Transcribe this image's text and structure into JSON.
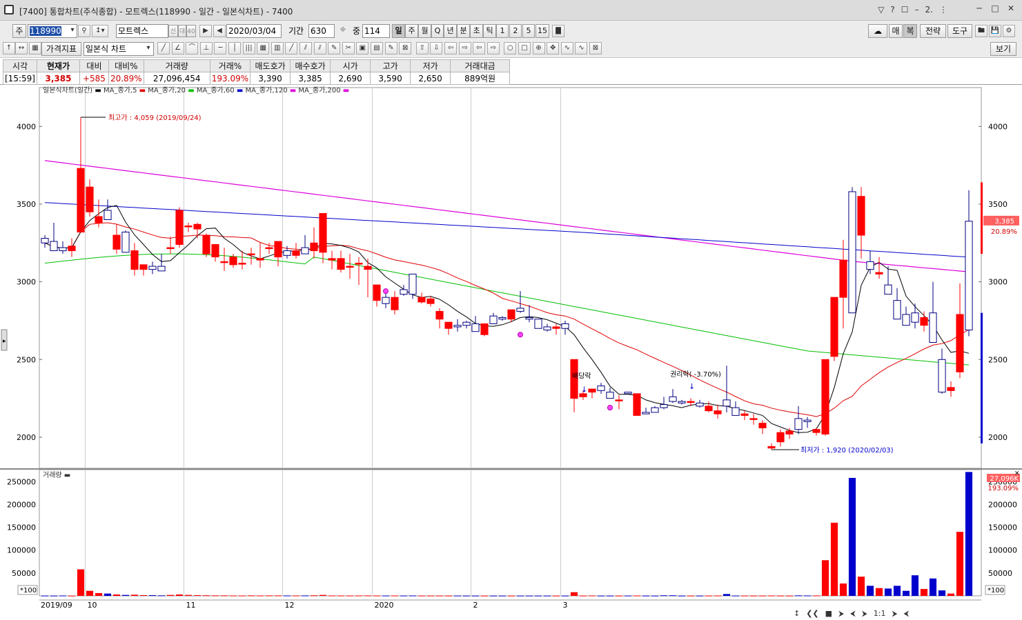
{
  "window": {
    "title": "[7400] 통합차트(주식종합) - 모트렉스(118990 - 일간 - 일본식차트) - 7400",
    "top_icons": [
      "▽",
      "?",
      "☐",
      "–",
      "2.",
      "⋮"
    ]
  },
  "toolbar1": {
    "market_label": "주",
    "code": "118990",
    "name": "모트렉스",
    "name_badges": [
      "신",
      "대",
      "40"
    ],
    "date": "2020/03/04",
    "period_label": "기간",
    "period_value": "630",
    "count_label": "중",
    "count_value": "114",
    "intervals": [
      "일",
      "주",
      "월",
      "Q",
      "년",
      "분",
      "초",
      "틱",
      "1",
      "2",
      "5",
      "15"
    ],
    "right_buttons": [
      "매",
      "복",
      "전략",
      "도구"
    ]
  },
  "toolbar2": {
    "price_index": "가격지표",
    "chart_type": "일본식 차트",
    "view_label": "보기"
  },
  "quote": {
    "headers": [
      "시각",
      "현재가",
      "대비",
      "대비%",
      "거래량",
      "거래%",
      "매도호가",
      "매수호가",
      "시가",
      "고가",
      "저가",
      "거래대금"
    ],
    "values": [
      "[15:59]",
      "3,385",
      "+585",
      "20.89%",
      "27,096,454",
      "193.09%",
      "3,390",
      "3,385",
      "2,690",
      "3,590",
      "2,650",
      "889억원"
    ]
  },
  "chart_data": {
    "type": "candlestick",
    "title": "일본식차트(일간)",
    "legend": [
      "MA_종가,5",
      "MA_종가,20",
      "MA_종가,60",
      "MA_종가,120",
      "MA_종가,200"
    ],
    "legend_colors": [
      "#000000",
      "#e00000",
      "#00c000",
      "#0000cc",
      "#dd00dd"
    ],
    "y_ticks": [
      2000,
      2500,
      3000,
      3500,
      4000
    ],
    "ylim": [
      1800,
      4250
    ],
    "x_labels": [
      "2019/09",
      "10",
      "11",
      "12",
      "2020",
      "2",
      "3"
    ],
    "x_label_idx": [
      0,
      5,
      16,
      27,
      37,
      48,
      58
    ],
    "annotations": {
      "high": "최고가 : 4,059 (2019/09/24)",
      "low": "최저가 : 1,920 (2020/02/03)",
      "dividend": "배당락",
      "rights": "권리락( -3.70%)"
    },
    "candles": [
      [
        3280,
        3300,
        3220,
        3250
      ],
      [
        3260,
        3380,
        3200,
        3200
      ],
      [
        3220,
        3260,
        3180,
        3200
      ],
      [
        3200,
        3280,
        3160,
        3230
      ],
      [
        3320,
        4059,
        3320,
        3730
      ],
      [
        3450,
        3660,
        3420,
        3610
      ],
      [
        3380,
        3530,
        3350,
        3420
      ],
      [
        3460,
        3530,
        3400,
        3400
      ],
      [
        3210,
        3370,
        3180,
        3300
      ],
      [
        3320,
        3330,
        3200,
        3190
      ],
      [
        3080,
        3250,
        3040,
        3200
      ],
      [
        3080,
        3110,
        3040,
        3110
      ],
      [
        3100,
        3130,
        3050,
        3080
      ],
      [
        3100,
        3180,
        3070,
        3070
      ],
      [
        3220,
        3290,
        3180,
        3220
      ],
      [
        3240,
        3480,
        3220,
        3460
      ],
      [
        3360,
        3380,
        3320,
        3360
      ],
      [
        3340,
        3380,
        3280,
        3370
      ],
      [
        3180,
        3310,
        3160,
        3300
      ],
      [
        3160,
        3240,
        3130,
        3240
      ],
      [
        3130,
        3220,
        3070,
        3130
      ],
      [
        3110,
        3180,
        3090,
        3160
      ],
      [
        3120,
        3200,
        3080,
        3120
      ],
      [
        3180,
        3220,
        3110,
        3180
      ],
      [
        3140,
        3250,
        3090,
        3150
      ],
      [
        3220,
        3250,
        3180,
        3220
      ],
      [
        3160,
        3250,
        3100,
        3260
      ],
      [
        3200,
        3230,
        3150,
        3170
      ],
      [
        3170,
        3250,
        3150,
        3200
      ],
      [
        3220,
        3300,
        3180,
        3180
      ],
      [
        3200,
        3350,
        3150,
        3250
      ],
      [
        3190,
        3230,
        3120,
        3440
      ],
      [
        3140,
        3200,
        3080,
        3150
      ],
      [
        3080,
        3200,
        3060,
        3150
      ],
      [
        3100,
        3180,
        3020,
        3100
      ],
      [
        3120,
        3160,
        2980,
        3120
      ],
      [
        3080,
        3150,
        2900,
        3100
      ],
      [
        2880,
        2920,
        2840,
        2980
      ],
      [
        2900,
        2950,
        2830,
        2860
      ],
      [
        2820,
        2940,
        2790,
        2900
      ],
      [
        2950,
        2980,
        2910,
        2920
      ],
      [
        3050,
        3050,
        2890,
        2920
      ],
      [
        2870,
        2930,
        2860,
        2900
      ],
      [
        2860,
        2910,
        2840,
        2890
      ],
      [
        2760,
        2830,
        2700,
        2810
      ],
      [
        2700,
        2740,
        2660,
        2740
      ],
      [
        2720,
        2760,
        2680,
        2710
      ],
      [
        2740,
        2750,
        2700,
        2720
      ],
      [
        2730,
        2780,
        2680,
        2680
      ],
      [
        2660,
        2720,
        2650,
        2730
      ],
      [
        2780,
        2800,
        2760,
        2730
      ],
      [
        2770,
        2780,
        2750,
        2760
      ],
      [
        2760,
        2800,
        2740,
        2820
      ],
      [
        2830,
        2940,
        2800,
        2810
      ],
      [
        2770,
        2850,
        2740,
        2760
      ],
      [
        2760,
        2760,
        2700,
        2700
      ],
      [
        2710,
        2730,
        2680,
        2690
      ],
      [
        2700,
        2730,
        2660,
        2710
      ],
      [
        2730,
        2750,
        2660,
        2700
      ],
      [
        2250,
        2300,
        2160,
        2500
      ],
      [
        2260,
        2300,
        2240,
        2280
      ],
      [
        2290,
        2310,
        2250,
        2310
      ],
      [
        2330,
        2350,
        2280,
        2300
      ],
      [
        2290,
        2320,
        2270,
        2250
      ],
      [
        2240,
        2270,
        2180,
        2240
      ],
      [
        2290,
        2290,
        2280,
        2280
      ],
      [
        2140,
        2150,
        2140,
        2280
      ],
      [
        2160,
        2190,
        2150,
        2150
      ],
      [
        2190,
        2200,
        2160,
        2160
      ],
      [
        2210,
        2260,
        2180,
        2190
      ],
      [
        2260,
        2310,
        2220,
        2230
      ],
      [
        2230,
        2240,
        2210,
        2220
      ],
      [
        2230,
        2250,
        2200,
        2230
      ],
      [
        2220,
        2240,
        2190,
        2200
      ],
      [
        2170,
        2230,
        2160,
        2200
      ],
      [
        2150,
        2210,
        2120,
        2170
      ],
      [
        2240,
        2460,
        2160,
        2200
      ],
      [
        2190,
        2230,
        2140,
        2140
      ],
      [
        2140,
        2170,
        2110,
        2150
      ],
      [
        2120,
        2150,
        2080,
        2120
      ],
      [
        2060,
        2110,
        2020,
        2090
      ],
      [
        1930,
        1960,
        1920,
        1940
      ],
      [
        1970,
        2050,
        1940,
        2030
      ],
      [
        2020,
        2060,
        1990,
        2040
      ],
      [
        2120,
        2200,
        2020,
        2050
      ],
      [
        2110,
        2130,
        2060,
        2100
      ],
      [
        2030,
        2060,
        2010,
        2050
      ],
      [
        2020,
        2300,
        2010,
        2500
      ],
      [
        2520,
        2860,
        2490,
        2900
      ],
      [
        2900,
        3270,
        2700,
        3140
      ],
      [
        3580,
        3610,
        2840,
        2800
      ],
      [
        3300,
        3610,
        3150,
        3550
      ],
      [
        3130,
        3200,
        3050,
        3080
      ],
      [
        3050,
        3160,
        3020,
        3060
      ],
      [
        2980,
        3100,
        2940,
        2920
      ],
      [
        2880,
        2960,
        2840,
        2760
      ],
      [
        2790,
        2840,
        2720,
        2720
      ],
      [
        2800,
        2860,
        2700,
        2740
      ],
      [
        2720,
        2810,
        2680,
        2770
      ],
      [
        2800,
        3000,
        2670,
        2610
      ],
      [
        2500,
        2570,
        2280,
        2290
      ],
      [
        2300,
        2360,
        2260,
        2320
      ],
      [
        2420,
        2990,
        2380,
        2790
      ],
      [
        3390,
        3590,
        2650,
        2690
      ]
    ],
    "volume": {
      "yticks": [
        50000,
        100000,
        150000,
        200000,
        250000
      ],
      "ylim": [
        0,
        270000
      ],
      "unit": "*100",
      "last_value": "27,096K",
      "last_pct": "193.09%"
    },
    "last_price": "3,385",
    "last_pct": "20.89%"
  },
  "status_icons": [
    "↕",
    "❮❮",
    "■",
    "⮞",
    "⮜",
    "⮞",
    "1:1",
    "⮞",
    "⮜"
  ]
}
